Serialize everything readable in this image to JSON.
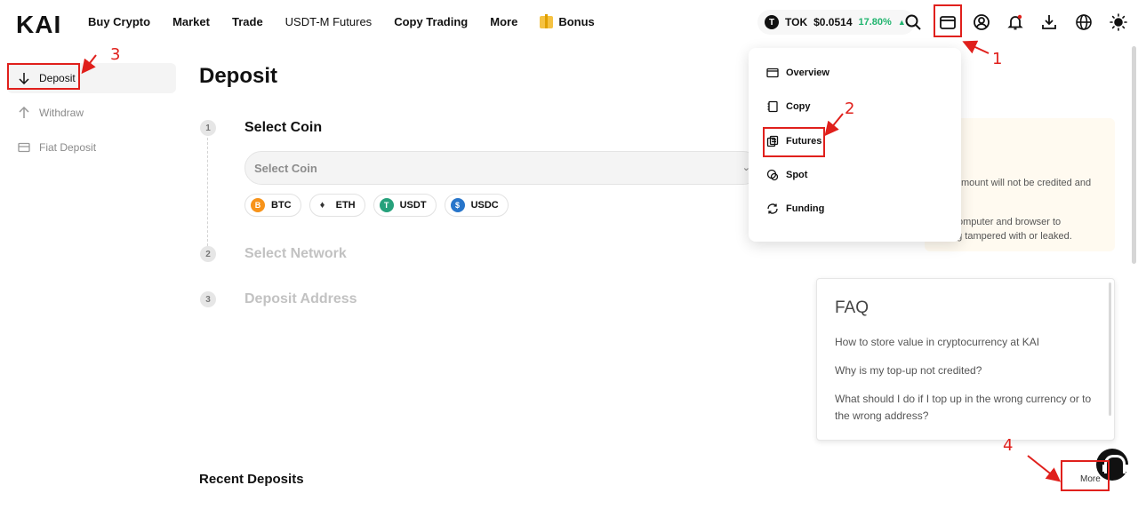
{
  "header": {
    "logo": "KAI",
    "nav": [
      "Buy Crypto",
      "Market",
      "Trade",
      "USDT-M Futures",
      "Copy Trading",
      "More"
    ],
    "bonus": "Bonus",
    "ticker": {
      "symbol": "TOK",
      "price": "$0.0514",
      "change": "17.80%",
      "icon_letter": "T"
    }
  },
  "sidebar": {
    "items": [
      {
        "label": "Deposit",
        "icon": "arrow-down-icon",
        "active": true
      },
      {
        "label": "Withdraw",
        "icon": "arrow-up-icon",
        "active": false
      },
      {
        "label": "Fiat Deposit",
        "icon": "card-icon",
        "active": false
      }
    ]
  },
  "main": {
    "title": "Deposit",
    "steps": [
      {
        "num": "1",
        "label": "Select Coin"
      },
      {
        "num": "2",
        "label": "Select Network"
      },
      {
        "num": "3",
        "label": "Deposit Address"
      }
    ],
    "select_placeholder": "Select Coin",
    "coins": [
      {
        "symbol": "BTC",
        "color": "#f7931a",
        "glyph": "B"
      },
      {
        "symbol": "ETH",
        "color": "#ffffff",
        "glyph": "♦"
      },
      {
        "symbol": "USDT",
        "color": "#26a17b",
        "glyph": "T"
      },
      {
        "symbol": "USDC",
        "color": "#2775ca",
        "glyph": "$"
      }
    ],
    "recent_title": "Recent Deposits",
    "more_label": "More"
  },
  "notice": {
    "line1": "mount will not be credited and",
    "line2": "omputer and browser to",
    "line3": "ng tampered with or leaked."
  },
  "faq": {
    "title": "FAQ",
    "questions": [
      "How to store value in cryptocurrency at KAI",
      "Why is my top-up not credited?",
      "What should I do if I top up in the wrong currency or to the wrong address?"
    ]
  },
  "dropdown": {
    "items": [
      "Overview",
      "Copy",
      "Futures",
      "Spot",
      "Funding"
    ]
  },
  "annotations": [
    "1",
    "2",
    "3",
    "4"
  ],
  "colors": {
    "accent_green": "#1fb46e",
    "annotation_red": "#e0201c"
  }
}
